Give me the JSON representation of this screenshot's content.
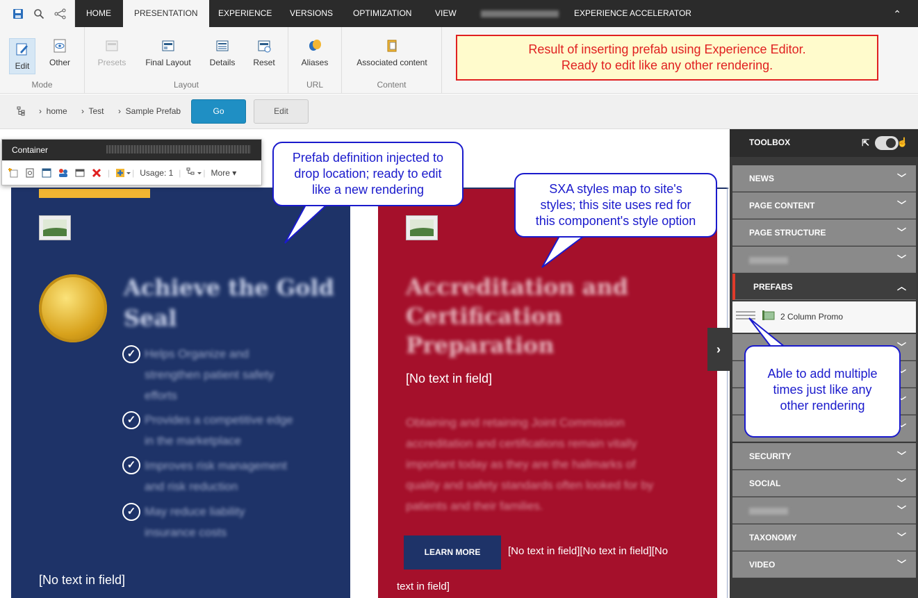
{
  "tabs": [
    "HOME",
    "PRESENTATION",
    "EXPERIENCE",
    "VERSIONS",
    "OPTIMIZATION",
    "VIEW",
    "EXPERIENCE ACCELERATOR"
  ],
  "ribbon": {
    "mode": {
      "label": "Mode",
      "edit": "Edit",
      "other": "Other"
    },
    "layout": {
      "label": "Layout",
      "presets": "Presets",
      "final_layout": "Final Layout",
      "details": "Details",
      "reset": "Reset"
    },
    "url": {
      "label": "URL",
      "aliases": "Aliases"
    },
    "content": {
      "label": "Content",
      "associated": "Associated content"
    }
  },
  "note": {
    "line1": "Result of inserting prefab using Experience Editor.",
    "line2": "Ready to edit like any other rendering."
  },
  "breadcrumb": [
    "home",
    "Test",
    "Sample Prefab"
  ],
  "buttons": {
    "go": "Go",
    "edit": "Edit"
  },
  "container_toolbar": {
    "title": "Container",
    "usage": "Usage: 1",
    "more": "More"
  },
  "content": {
    "no_text": "[No text in field]",
    "no_text_combined_1": "[No text in field][No text in field][No",
    "no_text_combined_2": "text in field]",
    "learn_more": "LEARN MORE"
  },
  "toolbox": {
    "title": "TOOLBOX",
    "items": [
      "NEWS",
      "PAGE CONTENT",
      "PAGE STRUCTURE",
      "",
      "PREFABS",
      "",
      "",
      "",
      "",
      "SECURITY",
      "SOCIAL",
      "",
      "TAXONOMY",
      "VIDEO"
    ],
    "prefab_item": "2 Column Promo"
  },
  "bubbles": {
    "prefab": [
      "Prefab definition injected to",
      "drop location; ready to edit",
      "like a new rendering"
    ],
    "sxa": [
      "SXA styles map to site's",
      "styles; this site uses red for",
      "this component's style option"
    ],
    "multiple": [
      "Able to add multiple",
      "times just like any",
      "other rendering"
    ]
  },
  "colors": {
    "left_panel": "#1e3368",
    "right_panel": "#a5102b",
    "go_button": "#1f8fc4",
    "callout_border": "#1a1acc",
    "note_text": "#e02020"
  }
}
